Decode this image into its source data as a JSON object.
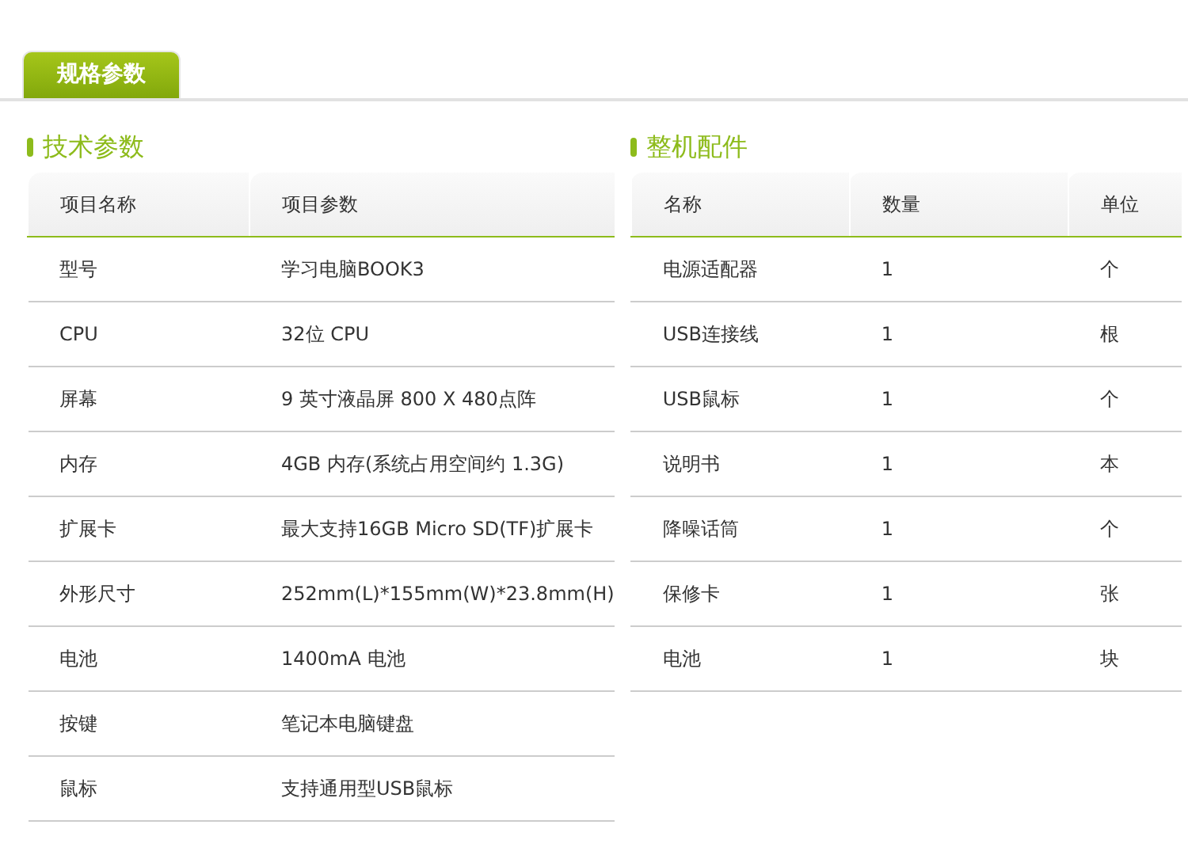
{
  "tabs": [
    {
      "label": "规格参数",
      "selected": true
    }
  ],
  "sections": [
    {
      "title": "技术参数",
      "columns": [
        "项目名称",
        "项目参数"
      ],
      "rows": [
        [
          "型号",
          "学习电脑BOOK3"
        ],
        [
          "CPU",
          "32位 CPU"
        ],
        [
          "屏幕",
          "9 英寸液晶屏 800 X 480点阵"
        ],
        [
          "内存",
          "4GB 内存(系统占用空间约 1.3G)"
        ],
        [
          "扩展卡",
          "最大支持16GB Micro SD(TF)扩展卡"
        ],
        [
          "外形尺寸",
          "252mm(L)*155mm(W)*23.8mm(H)"
        ],
        [
          "电池",
          "1400mA 电池"
        ],
        [
          "按键",
          "笔记本电脑键盘"
        ],
        [
          "鼠标",
          "支持通用型USB鼠标"
        ]
      ]
    },
    {
      "title": "整机配件",
      "columns": [
        "名称",
        "数量",
        "单位"
      ],
      "rows": [
        [
          "电源适配器",
          "1",
          "个"
        ],
        [
          "USB连接线",
          "1",
          "根"
        ],
        [
          "USB鼠标",
          "1",
          "个"
        ],
        [
          "说明书",
          "1",
          "本"
        ],
        [
          "降噪话筒",
          "1",
          "个"
        ],
        [
          "保修卡",
          "1",
          "张"
        ],
        [
          "电池",
          "1",
          "块"
        ]
      ]
    }
  ]
}
